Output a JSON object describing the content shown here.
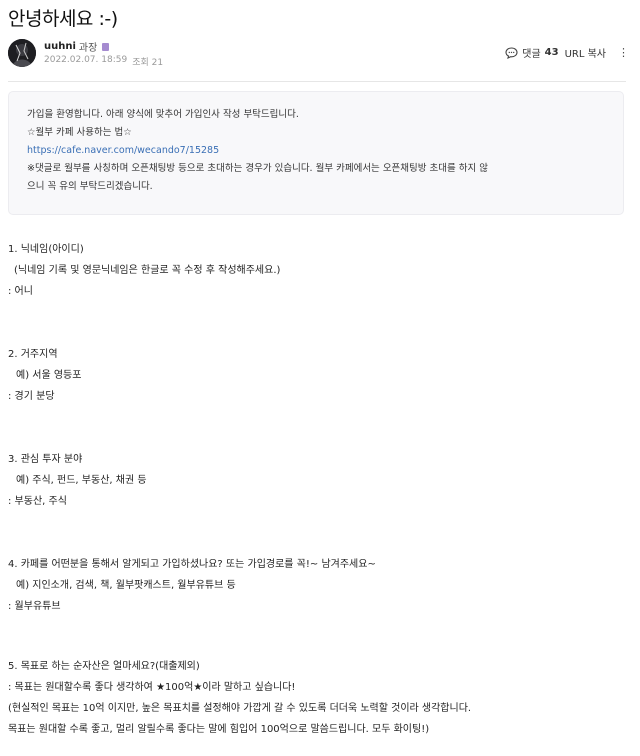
{
  "post": {
    "title": "안녕하세요 :-)",
    "author": "uuhni",
    "rank": "과장",
    "date": "2022.02.07. 18:59",
    "views": "조회 21",
    "comments_label": "댓글",
    "comments_count": "43",
    "url_copy": "URL 복사"
  },
  "notice": {
    "lines": [
      "가입을 환영합니다. 아래 양식에 맞추어 가입인사 작성 부탁드립니다.",
      "☆월부 카페 사용하는 법☆",
      "https://cafe.naver.com/wecando7/15285",
      "※댓글로 월부를 사칭하며 오픈채팅방 등으로 초대하는 경우가 있습니다. 월부 카페에서는 오픈채팅방 초대를 하지 않",
      "으니 꼭 유의 부탁드리겠습니다."
    ]
  },
  "content": {
    "q1": [
      "1. 닉네임(아이디)",
      "(닉네임 기록 및 영문닉네임은 한글로 꼭 수정 후 작성해주세요.)",
      ": 어니"
    ],
    "q2": [
      "2. 거주지역",
      "예) 서울 영등포",
      ": 경기 분당"
    ],
    "q3": [
      "3. 관심 투자 분야",
      "예) 주식, 펀드, 부동산, 채권 등",
      ": 부동산, 주식"
    ],
    "q4": [
      "4. 카페를 어떤분을 통해서 알게되고 가입하셨나요? 또는 가입경로를 꼭!~ 남겨주세요~",
      "예) 지인소개, 검색, 책, 월부팟캐스트, 월부유튜브 등",
      ": 월부유튜브"
    ],
    "q5": [
      "5. 목표로 하는 순자산은 얼마세요?(대출제외)",
      ": 목표는 원대할수록 좋다 생각하여 ★100억★이라 말하고 싶습니다!",
      "(현실적인 목표는 10억 이지만, 높은 목표치를 설정해야 가깝게 갈 수 있도록 더더욱 노력할 것이라 생각합니다.",
      "목표는 원대할 수록 좋고, 멀리 알릴수록 좋다는 말에 힘입어 100억으로 말씀드립니다. 모두 화이팅!)"
    ]
  }
}
